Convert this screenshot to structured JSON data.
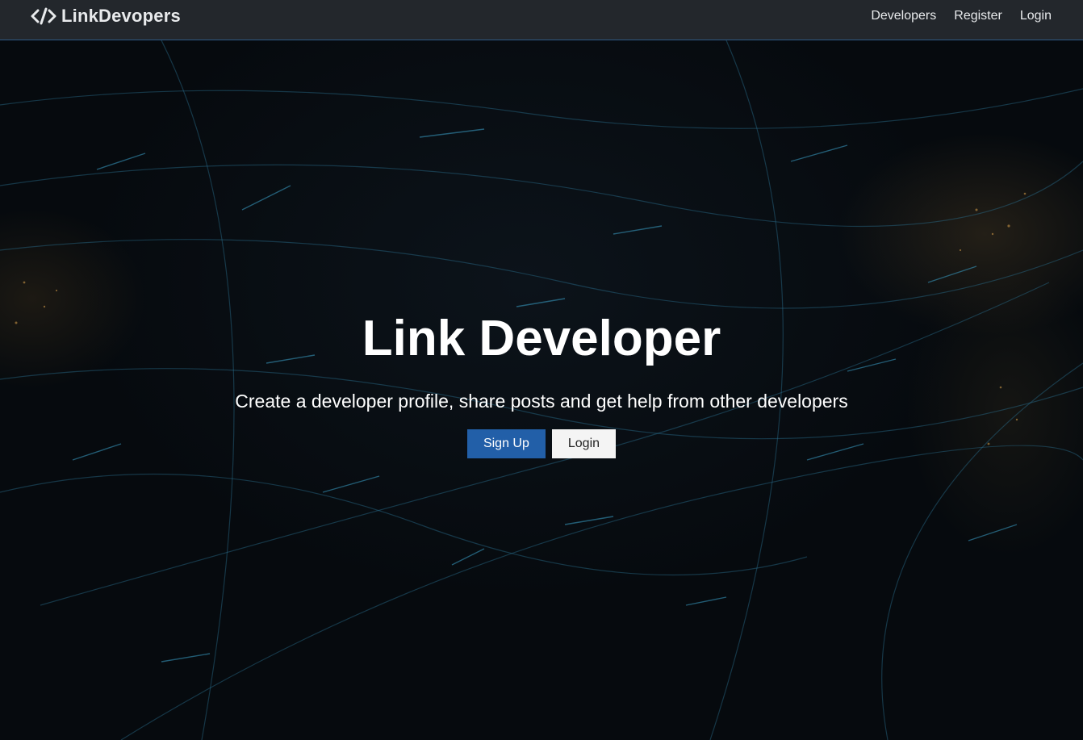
{
  "navbar": {
    "brand": "LinkDevopers",
    "brand_icon": "code-icon",
    "links": [
      "Developers",
      "Register",
      "Login"
    ]
  },
  "hero": {
    "title": "Link Developer",
    "lead": "Create a developer profile, share posts and get help from other developers",
    "signup_label": "Sign Up",
    "login_label": "Login"
  },
  "colors": {
    "navbar_bg": "#23272c",
    "primary": "#225fa8",
    "light": "#f4f4f4",
    "background": "#070a0e"
  }
}
